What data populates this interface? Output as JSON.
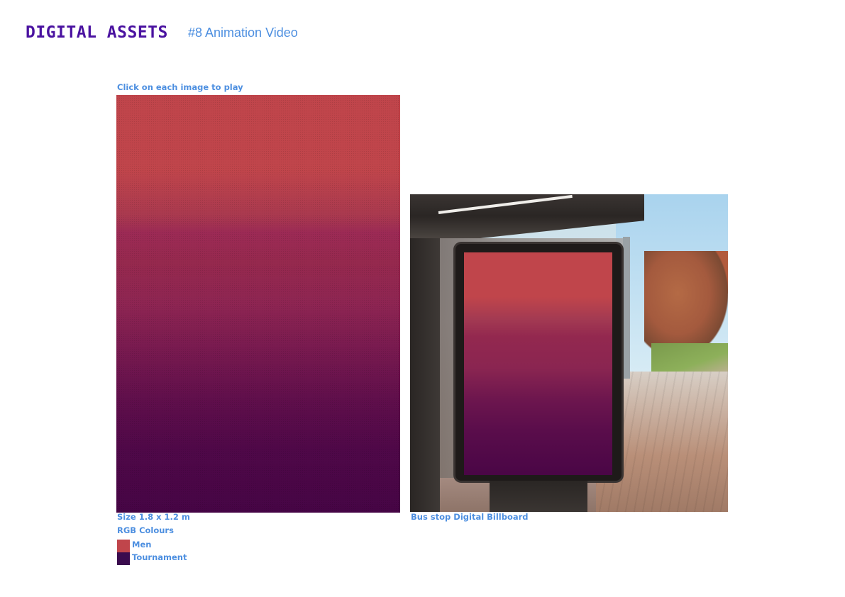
{
  "header": {
    "title": "DIGITAL ASSETS",
    "subtitle": "#8 Animation Video"
  },
  "instruction": "Click on each image to play",
  "poster": {
    "size_label": "Size 1.8 x 1.2 m",
    "colours_label": "RGB Colours"
  },
  "billboard": {
    "caption": "Bus stop Digital Billboard"
  },
  "legend": [
    {
      "label": "Men",
      "color": "#c0454b"
    },
    {
      "label": "Tournament",
      "color": "#3a0b4e"
    }
  ]
}
